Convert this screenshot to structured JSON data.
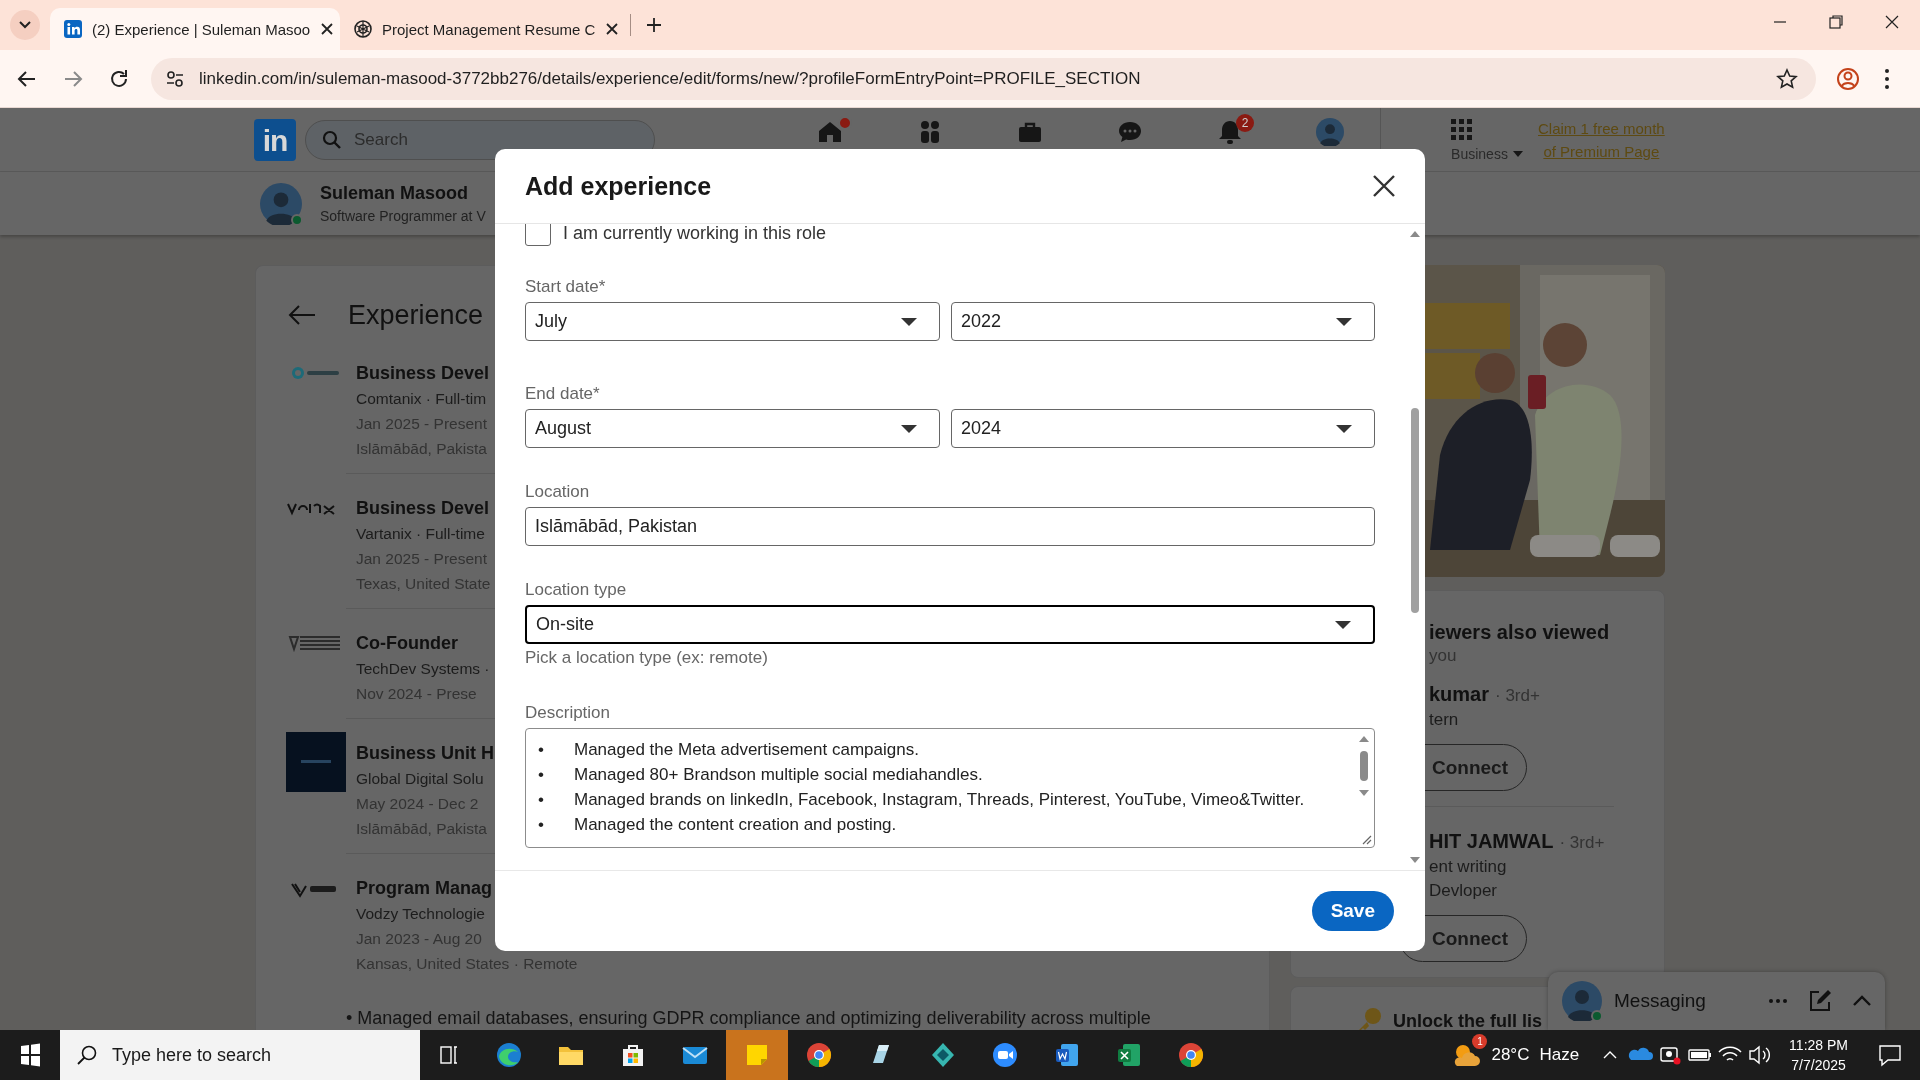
{
  "browser": {
    "tabs": [
      {
        "title": "(2) Experience | Suleman Masoo",
        "kind": "linkedin",
        "selected": true
      },
      {
        "title": "Project Management Resume C",
        "kind": "knot",
        "selected": false
      }
    ],
    "url": "linkedin.com/in/suleman-masood-3772bb276/details/experience/edit/forms/new/?profileFormEntryPoint=PROFILE_SECTION"
  },
  "header": {
    "logo": "in",
    "search": {
      "placeholder": "Search"
    },
    "nav": [
      {
        "kind": "home",
        "badge_dot": true
      },
      {
        "kind": "network",
        "badge_dot": false
      },
      {
        "kind": "jobs",
        "badge_dot": false
      },
      {
        "kind": "messaging",
        "badge_dot": false
      },
      {
        "kind": "notifications",
        "badge_dot": false,
        "badge": "2"
      },
      {
        "kind": "me",
        "badge_dot": false
      }
    ],
    "business": "Business",
    "premium_link": [
      "Claim 1 free month",
      "of Premium Page"
    ]
  },
  "profile": {
    "name": "Suleman Masood",
    "headline": "Software Programmer at V",
    "online": true
  },
  "experience": {
    "title": "Experience",
    "entries": [
      {
        "kind": "ring",
        "title": "Business Devel",
        "company": "Comtanix · Full-tim",
        "dates": "Jan 2025 - Present",
        "location": "Islāmābād, Pakista"
      },
      {
        "kind": "wave",
        "title": "Business Devel",
        "company": "Vartanix · Full-time",
        "dates": "Jan 2025 - Present",
        "location": "Texas, United State"
      },
      {
        "kind": "stripes",
        "title": "Co-Founder",
        "company": "TechDev Systems ·",
        "dates": "Nov 2024 - Prese"
      },
      {
        "kind": "dark",
        "title": "Business Unit H",
        "company": "Global Digital Solu",
        "dates": "May 2024 - Dec 2",
        "location": "Islāmābād, Pakista"
      },
      {
        "kind": "wing",
        "title": "Program Manag",
        "company": "Vodzy Technologie",
        "dates": "Jan 2023 - Aug 20",
        "location": "Kansas, United States · Remote"
      }
    ],
    "bullet": "• Managed email databases, ensuring GDPR compliance and optimizing deliverability across multiple"
  },
  "sidebar": {
    "viewers": {
      "title": "iewers also viewed",
      "subtitle": "you",
      "people": [
        {
          "name": "kumar",
          "degree": "· 3rd+",
          "lines": [
            "tern"
          ],
          "action": "Connect"
        },
        {
          "name": "HIT JAMWAL",
          "degree": "· 3rd+",
          "lines": [
            "ent writing",
            "Devloper"
          ],
          "action": "Connect"
        }
      ]
    },
    "unlock": "Unlock the full lis"
  },
  "messaging": {
    "title": "Messaging",
    "online": true
  },
  "modal": {
    "title": "Add experience",
    "current_role": {
      "label": "I am currently working in this role",
      "checked": false
    },
    "start_date": {
      "label": "Start date*",
      "month": "July",
      "year": "2022"
    },
    "end_date": {
      "label": "End date*",
      "month": "August",
      "year": "2024"
    },
    "location": {
      "label": "Location",
      "value": "Islāmābād, Pakistan"
    },
    "location_type": {
      "label": "Location type",
      "value": "On-site",
      "focused": true,
      "hint": "Pick a location type (ex: remote)"
    },
    "description": {
      "label": "Description",
      "lines": [
        {
          "bullet": "•",
          "text": "Managed the Meta advertisement campaigns."
        },
        {
          "bullet": "•",
          "text": "Managed 80+ Brandson multiple social mediahandles."
        },
        {
          "bullet": "•",
          "text": "Managed brands on linkedIn, Facebook, Instagram, Threads, Pinterest, YouTube, Vimeo&Twitter."
        },
        {
          "bullet": "•",
          "text": "Managed the content creation and posting."
        }
      ]
    },
    "save": "Save"
  },
  "taskbar": {
    "search": {
      "placeholder": "Type here to search"
    },
    "apps": [
      {
        "kind": "edge",
        "selected": false
      },
      {
        "kind": "folder",
        "selected": false
      },
      {
        "kind": "store",
        "selected": false
      },
      {
        "kind": "mail",
        "selected": false
      },
      {
        "kind": "sticky",
        "selected": true
      },
      {
        "kind": "chrome",
        "selected": false
      },
      {
        "kind": "crystal",
        "selected": false
      },
      {
        "kind": "diamond",
        "selected": false
      },
      {
        "kind": "video",
        "selected": false
      },
      {
        "kind": "word",
        "selected": false
      },
      {
        "kind": "excel",
        "selected": false
      },
      {
        "kind": "chrome",
        "selected": false
      }
    ],
    "weather": {
      "badge": "1",
      "temp": "28°C",
      "condition": "Haze"
    },
    "time": "11:28 PM",
    "date": "7/7/2025"
  }
}
